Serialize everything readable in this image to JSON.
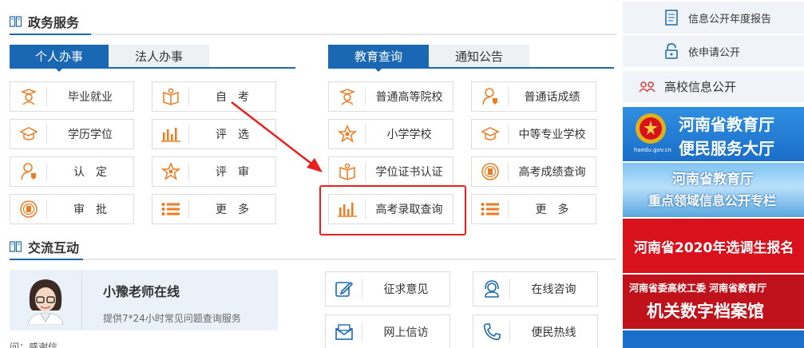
{
  "gov_services": {
    "title": "政务服务",
    "left_tabs": [
      "个人办事",
      "法人办事"
    ],
    "left_buttons": [
      {
        "icon": "graduate-icon",
        "label": "毕业就业"
      },
      {
        "icon": "book-open-icon",
        "label": "自　考"
      },
      {
        "icon": "mortarboard-icon",
        "label": "学历学位"
      },
      {
        "icon": "bar-chart-icon",
        "label": "评　选"
      },
      {
        "icon": "person-badge-icon",
        "label": "认　定"
      },
      {
        "icon": "star-icon",
        "label": "评　审"
      },
      {
        "icon": "stamp-icon",
        "label": "审　批"
      },
      {
        "icon": "list-icon",
        "label": "更　多"
      }
    ],
    "right_tabs": [
      "教育查询",
      "通知公告"
    ],
    "right_buttons": [
      {
        "icon": "graduate-icon",
        "label": "普通高等院校"
      },
      {
        "icon": "person-badge-icon",
        "label": "普通话成绩"
      },
      {
        "icon": "star-icon",
        "label": "小学学校"
      },
      {
        "icon": "mortarboard-icon",
        "label": "中等专业学校"
      },
      {
        "icon": "book-open-icon",
        "label": "学位证书认证"
      },
      {
        "icon": "stamp-icon",
        "label": "高考成绩查询"
      },
      {
        "icon": "bar-chart-icon",
        "label": "高考录取查询"
      },
      {
        "icon": "list-icon",
        "label": "更　多"
      }
    ]
  },
  "interaction": {
    "title": "交流互动",
    "teacher_name": "小豫老师在线",
    "teacher_desc": "提供7*24小时常见问题查询服务",
    "qa_preview": "问：感谢信",
    "buttons": [
      {
        "icon": "edit-icon",
        "label": "征求意见"
      },
      {
        "icon": "headset-icon",
        "label": "在线咨询"
      },
      {
        "icon": "mail-icon",
        "label": "网上信访"
      },
      {
        "icon": "phone-icon",
        "label": "便民热线"
      }
    ]
  },
  "sidebar": {
    "items": [
      {
        "icon": "document-icon",
        "label": "信息公开年度报告"
      },
      {
        "icon": "lock-icon",
        "label": "依申请公开"
      }
    ],
    "header": "高校信息公开",
    "banners": [
      {
        "line1": "河南省教育厅",
        "line2": "便民服务大厅",
        "sub": "haedu.gov.cn"
      },
      {
        "line1": "河南省教育厅",
        "line2": "重点领域信息公开专栏"
      },
      {
        "line1": "河南省2020年选调生报名"
      },
      {
        "line1": "河南省委高校工委 河南省教育厅",
        "line2": "机关数字档案馆"
      }
    ]
  },
  "colors": {
    "accent_blue": "#1a68b4",
    "icon_orange": "#f07a1e",
    "highlight_red": "#e8211f"
  }
}
